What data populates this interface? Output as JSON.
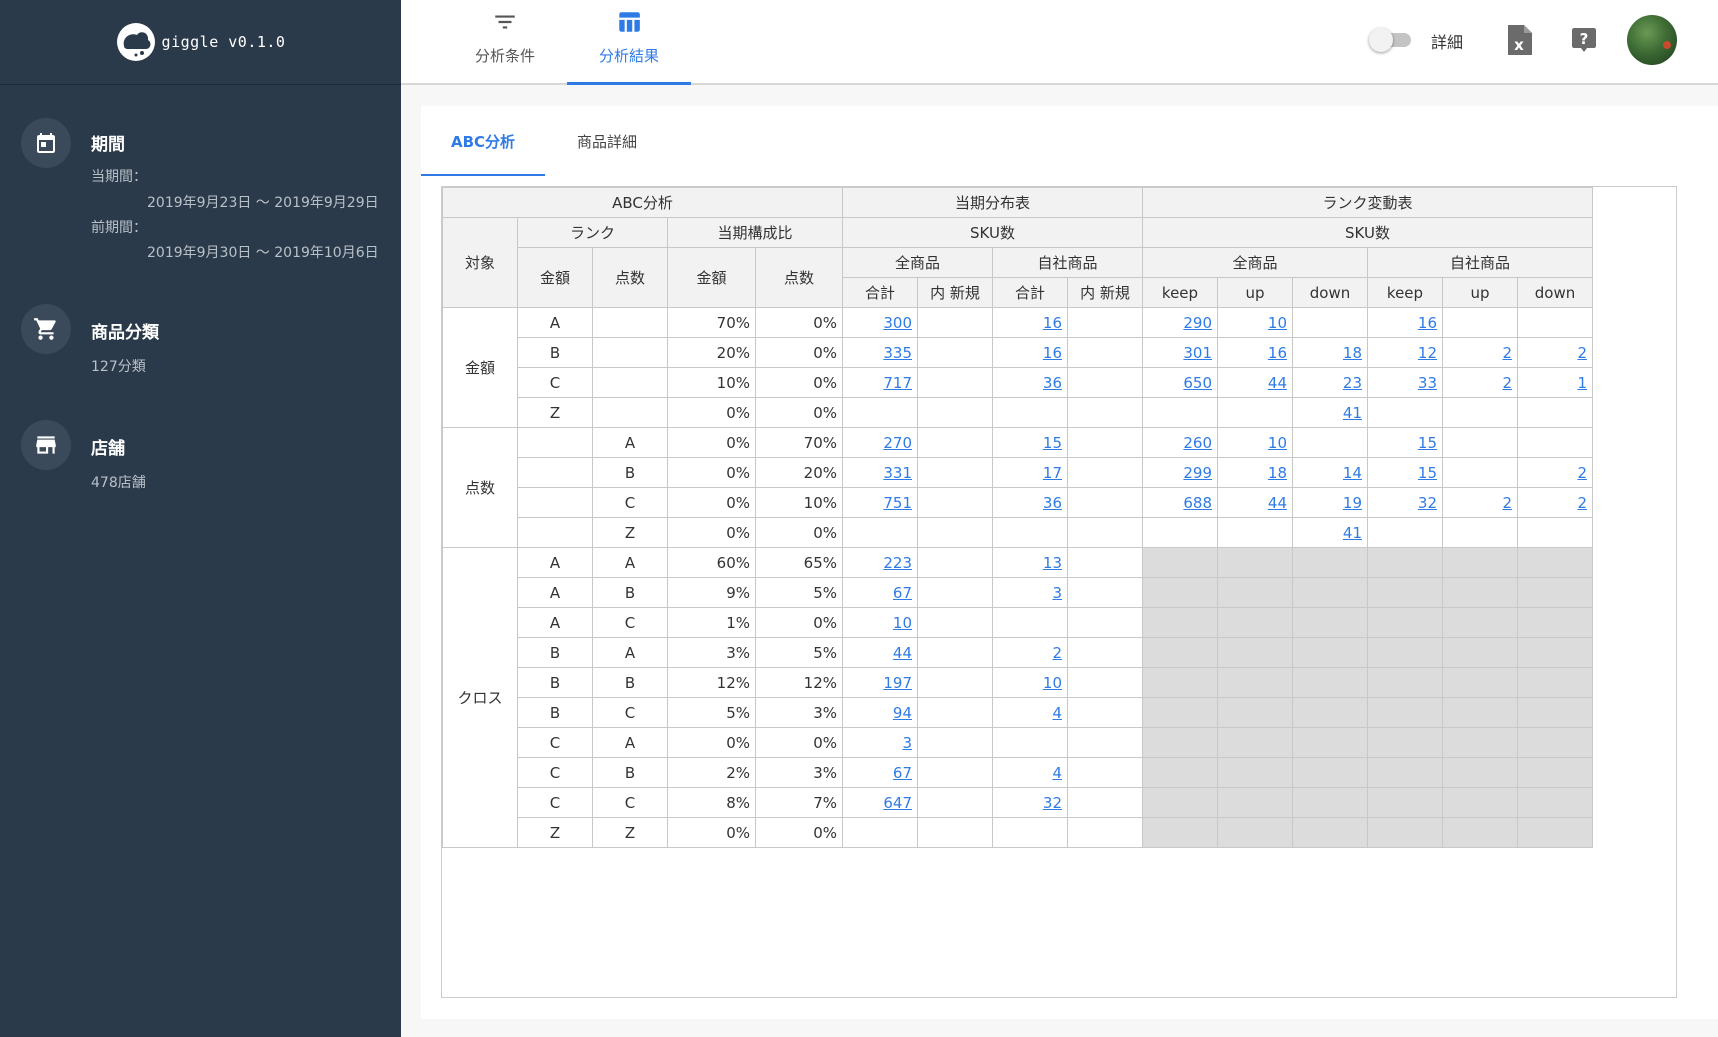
{
  "app": {
    "name": "giggle v0.1.0"
  },
  "sidebar": {
    "period": {
      "title": "期間",
      "current_label": "当期間：",
      "current_range": "2019年9月23日 ～ 2019年9月29日",
      "previous_label": "前期間：",
      "previous_range": "2019年9月30日 ～ 2019年10月6日"
    },
    "category": {
      "title": "商品分類",
      "value": "127分類"
    },
    "store": {
      "title": "店舗",
      "value": "478店舗"
    }
  },
  "topbar": {
    "tabs": [
      {
        "label": "分析条件",
        "icon": "filter-icon"
      },
      {
        "label": "分析結果",
        "icon": "table-icon",
        "active": true
      }
    ],
    "toggle_label": "詳細",
    "toggle_on": false,
    "icons": [
      "excel-export-icon",
      "help-icon",
      "avatar"
    ]
  },
  "subtabs": [
    {
      "label": "ABC分析",
      "active": true
    },
    {
      "label": "商品詳細"
    }
  ],
  "table": {
    "headers": {
      "abc": "ABC分析",
      "dist": "当期分布表",
      "rank_change": "ランク変動表",
      "target": "対象",
      "rank": "ランク",
      "ratio": "当期構成比",
      "sku_dist": "SKU数",
      "sku_change": "SKU数",
      "amount": "金額",
      "count": "点数",
      "ratio_amount": "金額",
      "ratio_count": "点数",
      "all_products": "全商品",
      "own_products": "自社商品",
      "change_all": "全商品",
      "change_own": "自社商品",
      "total": "合計",
      "new_of": "内 新規",
      "total2": "合計",
      "new_of2": "内 新規",
      "keep": "keep",
      "up": "up",
      "down": "down",
      "keep2": "keep",
      "up2": "up",
      "down2": "down"
    },
    "groups": [
      {
        "name": "金額",
        "rows": [
          {
            "rank_amount": "A",
            "rank_count": "",
            "ratio_amount": "70%",
            "ratio_count": "0%",
            "all_total": "300",
            "all_new": "",
            "own_total": "16",
            "own_new": "",
            "all_keep": "290",
            "all_up": "10",
            "all_down": "",
            "own_keep": "16",
            "own_up": "",
            "own_down": ""
          },
          {
            "rank_amount": "B",
            "rank_count": "",
            "ratio_amount": "20%",
            "ratio_count": "0%",
            "all_total": "335",
            "all_new": "",
            "own_total": "16",
            "own_new": "",
            "all_keep": "301",
            "all_up": "16",
            "all_down": "18",
            "own_keep": "12",
            "own_up": "2",
            "own_down": "2"
          },
          {
            "rank_amount": "C",
            "rank_count": "",
            "ratio_amount": "10%",
            "ratio_count": "0%",
            "all_total": "717",
            "all_new": "",
            "own_total": "36",
            "own_new": "",
            "all_keep": "650",
            "all_up": "44",
            "all_down": "23",
            "own_keep": "33",
            "own_up": "2",
            "own_down": "1"
          },
          {
            "rank_amount": "Z",
            "rank_count": "",
            "ratio_amount": "0%",
            "ratio_count": "0%",
            "all_total": "",
            "all_new": "",
            "own_total": "",
            "own_new": "",
            "all_keep": "",
            "all_up": "",
            "all_down": "41",
            "own_keep": "",
            "own_up": "",
            "own_down": ""
          }
        ]
      },
      {
        "name": "点数",
        "rows": [
          {
            "rank_amount": "",
            "rank_count": "A",
            "ratio_amount": "0%",
            "ratio_count": "70%",
            "all_total": "270",
            "all_new": "",
            "own_total": "15",
            "own_new": "",
            "all_keep": "260",
            "all_up": "10",
            "all_down": "",
            "own_keep": "15",
            "own_up": "",
            "own_down": ""
          },
          {
            "rank_amount": "",
            "rank_count": "B",
            "ratio_amount": "0%",
            "ratio_count": "20%",
            "all_total": "331",
            "all_new": "",
            "own_total": "17",
            "own_new": "",
            "all_keep": "299",
            "all_up": "18",
            "all_down": "14",
            "own_keep": "15",
            "own_up": "",
            "own_down": "2"
          },
          {
            "rank_amount": "",
            "rank_count": "C",
            "ratio_amount": "0%",
            "ratio_count": "10%",
            "all_total": "751",
            "all_new": "",
            "own_total": "36",
            "own_new": "",
            "all_keep": "688",
            "all_up": "44",
            "all_down": "19",
            "own_keep": "32",
            "own_up": "2",
            "own_down": "2"
          },
          {
            "rank_amount": "",
            "rank_count": "Z",
            "ratio_amount": "0%",
            "ratio_count": "0%",
            "all_total": "",
            "all_new": "",
            "own_total": "",
            "own_new": "",
            "all_keep": "",
            "all_up": "",
            "all_down": "41",
            "own_keep": "",
            "own_up": "",
            "own_down": ""
          }
        ]
      },
      {
        "name": "クロス",
        "rank_change_disabled": true,
        "rows": [
          {
            "rank_amount": "A",
            "rank_count": "A",
            "ratio_amount": "60%",
            "ratio_count": "65%",
            "all_total": "223",
            "all_new": "",
            "own_total": "13",
            "own_new": ""
          },
          {
            "rank_amount": "A",
            "rank_count": "B",
            "ratio_amount": "9%",
            "ratio_count": "5%",
            "all_total": "67",
            "all_new": "",
            "own_total": "3",
            "own_new": ""
          },
          {
            "rank_amount": "A",
            "rank_count": "C",
            "ratio_amount": "1%",
            "ratio_count": "0%",
            "all_total": "10",
            "all_new": "",
            "own_total": "",
            "own_new": ""
          },
          {
            "rank_amount": "B",
            "rank_count": "A",
            "ratio_amount": "3%",
            "ratio_count": "5%",
            "all_total": "44",
            "all_new": "",
            "own_total": "2",
            "own_new": ""
          },
          {
            "rank_amount": "B",
            "rank_count": "B",
            "ratio_amount": "12%",
            "ratio_count": "12%",
            "all_total": "197",
            "all_new": "",
            "own_total": "10",
            "own_new": ""
          },
          {
            "rank_amount": "B",
            "rank_count": "C",
            "ratio_amount": "5%",
            "ratio_count": "3%",
            "all_total": "94",
            "all_new": "",
            "own_total": "4",
            "own_new": ""
          },
          {
            "rank_amount": "C",
            "rank_count": "A",
            "ratio_amount": "0%",
            "ratio_count": "0%",
            "all_total": "3",
            "all_new": "",
            "own_total": "",
            "own_new": ""
          },
          {
            "rank_amount": "C",
            "rank_count": "B",
            "ratio_amount": "2%",
            "ratio_count": "3%",
            "all_total": "67",
            "all_new": "",
            "own_total": "4",
            "own_new": ""
          },
          {
            "rank_amount": "C",
            "rank_count": "C",
            "ratio_amount": "8%",
            "ratio_count": "7%",
            "all_total": "647",
            "all_new": "",
            "own_total": "32",
            "own_new": ""
          },
          {
            "rank_amount": "Z",
            "rank_count": "Z",
            "ratio_amount": "0%",
            "ratio_count": "0%",
            "all_total": "",
            "all_new": "",
            "own_total": "",
            "own_new": ""
          }
        ]
      }
    ]
  },
  "colors": {
    "accent": "#2f7be6",
    "sidebar_bg": "#2b3a4a",
    "disabled_cell": "#dcdcdc"
  }
}
